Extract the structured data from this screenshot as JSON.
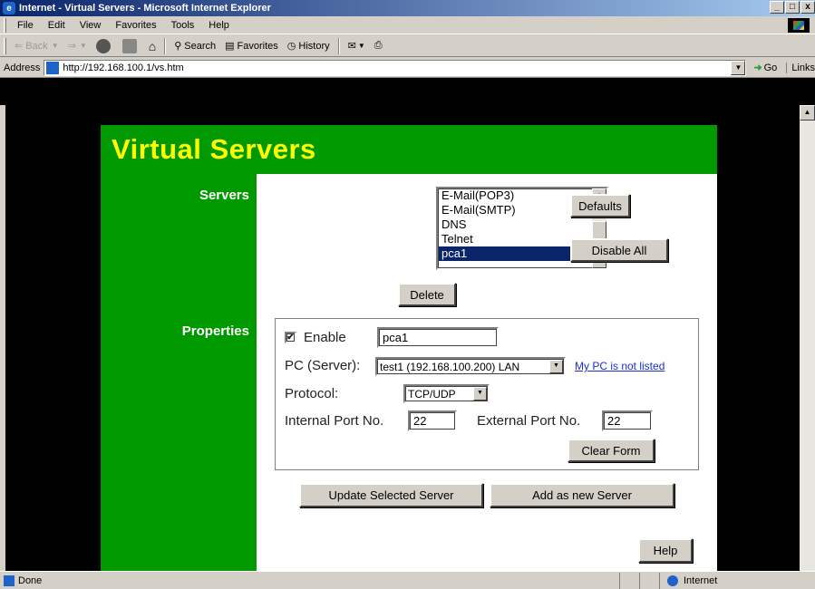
{
  "window": {
    "title": "Internet - Virtual Servers - Microsoft Internet Explorer",
    "controls": [
      "_",
      "□",
      "x"
    ]
  },
  "menu": {
    "items": [
      "File",
      "Edit",
      "View",
      "Favorites",
      "Tools",
      "Help"
    ]
  },
  "toolbar": {
    "back_label": "Back",
    "search_label": "Search",
    "favorites_label": "Favorites",
    "history_label": "History"
  },
  "address": {
    "label": "Address",
    "url": "http://192.168.100.1/vs.htm",
    "go_label": "Go",
    "links_label": "Links"
  },
  "page": {
    "heading": "Virtual Servers",
    "servers_label": "Servers",
    "properties_label": "Properties",
    "server_list": [
      "E-Mail(POP3)",
      "E-Mail(SMTP)",
      "DNS",
      "Telnet",
      "pca1"
    ],
    "selected_server": "pca1",
    "buttons": {
      "defaults": "Defaults",
      "disable_all": "Disable All",
      "delete": "Delete",
      "clear_form": "Clear Form",
      "update_selected": "Update Selected Server",
      "add_new": "Add as new Server",
      "help": "Help"
    },
    "form": {
      "enable_label": "Enable",
      "enable_checked": true,
      "name_value": "pca1",
      "pc_label": "PC (Server):",
      "pc_value": "test1 (192.168.100.200) LAN",
      "pc_link": "My PC is not listed",
      "protocol_label": "Protocol:",
      "protocol_value": "TCP/UDP",
      "internal_port_label": "Internal Port No.",
      "internal_port_value": "22",
      "external_port_label": "External Port No.",
      "external_port_value": "22"
    }
  },
  "status": {
    "text": "Done",
    "zone": "Internet"
  },
  "colors": {
    "brand_green": "#009900",
    "heading_yellow": "#ffff00",
    "selection_blue": "#0a246a",
    "link_blue": "#1a2fd0"
  }
}
